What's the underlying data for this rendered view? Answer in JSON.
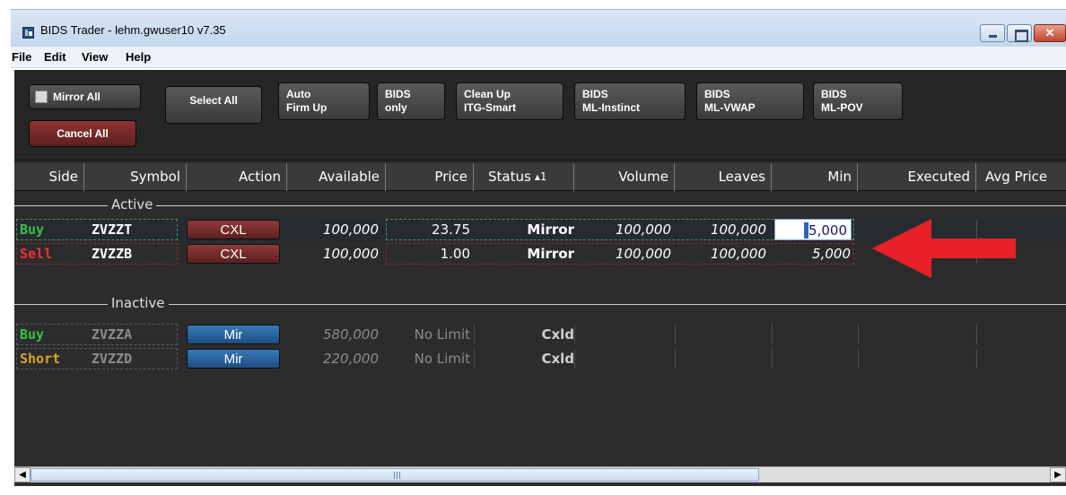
{
  "window": {
    "title": "BIDS Trader - lehm.gwuser10 v7.35"
  },
  "menu": [
    "File",
    "Edit",
    "View",
    "Help"
  ],
  "toolbar": {
    "mirror_all": "Mirror All",
    "cancel_all": "Cancel All",
    "select_all": "Select All",
    "auto_firm_up": [
      "Auto",
      "Firm Up"
    ],
    "bids_only": [
      "BIDS",
      "only"
    ],
    "clean_up": [
      "Clean Up",
      "ITG-Smart"
    ],
    "ml_instinct": [
      "BIDS",
      "ML-Instinct"
    ],
    "ml_vwap": [
      "BIDS",
      "ML-VWAP"
    ],
    "ml_pov": [
      "BIDS",
      "ML-POV"
    ]
  },
  "columns": {
    "side": "Side",
    "symbol": "Symbol",
    "action": "Action",
    "available": "Available",
    "price": "Price",
    "status": "Status",
    "status_sort": "1",
    "volume": "Volume",
    "leaves": "Leaves",
    "min": "Min",
    "executed": "Executed",
    "avg_price": "Avg Price"
  },
  "sections": {
    "active": "Active",
    "inactive": "Inactive"
  },
  "active_rows": [
    {
      "side": "Buy",
      "symbol": "ZVZZT",
      "action": "CXL",
      "available": "100,000",
      "price": "23.75",
      "status": "Mirror",
      "volume": "100,000",
      "leaves": "100,000",
      "min": "5,000"
    },
    {
      "side": "Sell",
      "symbol": "ZVZZB",
      "action": "CXL",
      "available": "100,000",
      "price": "1.00",
      "status": "Mirror",
      "volume": "100,000",
      "leaves": "100,000",
      "min": "5,000"
    }
  ],
  "inactive_rows": [
    {
      "side": "Buy",
      "symbol": "ZVZZA",
      "action": "Mir",
      "available": "580,000",
      "price": "No Limit",
      "status": "Cxld"
    },
    {
      "side": "Short",
      "symbol": "ZVZZD",
      "action": "Mir",
      "available": "220,000",
      "price": "No Limit",
      "status": "Cxld"
    }
  ],
  "colors": {
    "buy": "#31c24a",
    "sell": "#ff2e2e",
    "short": "#d7a62a",
    "cxl_button": "#7a2c2c",
    "mir_button": "#2a62a0",
    "annotation_arrow": "#e8202a"
  }
}
